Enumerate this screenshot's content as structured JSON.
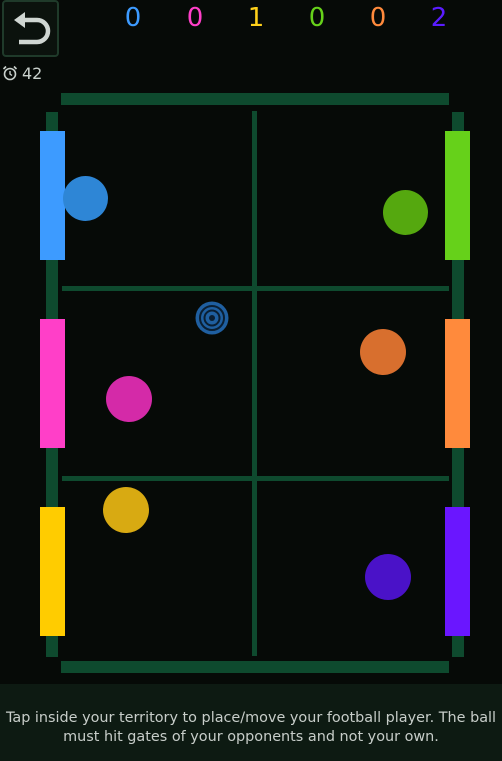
{
  "header": {
    "back_icon": "undo-arrow-icon",
    "timer_icon": "alarm-clock-icon",
    "timer_value": "42"
  },
  "scores": [
    {
      "player": "blue",
      "value": "0",
      "color": "#3d9bff"
    },
    {
      "player": "pink",
      "value": "0",
      "color": "#ff3fc8"
    },
    {
      "player": "yellow",
      "value": "1",
      "color": "#ffd11a"
    },
    {
      "player": "green",
      "value": "0",
      "color": "#66d11a"
    },
    {
      "player": "orange",
      "value": "0",
      "color": "#ff8a3c"
    },
    {
      "player": "purple",
      "value": "2",
      "color": "#5a1cff"
    }
  ],
  "colors": {
    "field_line": "#0e4a2e",
    "background": "#060a07",
    "gate_blue": "#3d9bff",
    "gate_pink": "#ff3fc8",
    "gate_yellow": "#ffcc00",
    "gate_green": "#66d11a",
    "gate_orange": "#ff8a3c",
    "gate_purple": "#6a16ff",
    "player_blue": "#2e86d6",
    "player_pink": "#d42aa8",
    "player_yellow": "#d8aa12",
    "player_green": "#55a80f",
    "player_orange": "#d86f2e",
    "player_purple": "#4a12c8",
    "ball": "#1f5fa0"
  },
  "instruction": "Tap inside your territory to place/move your football player. The ball must hit gates of your opponents and not your own."
}
